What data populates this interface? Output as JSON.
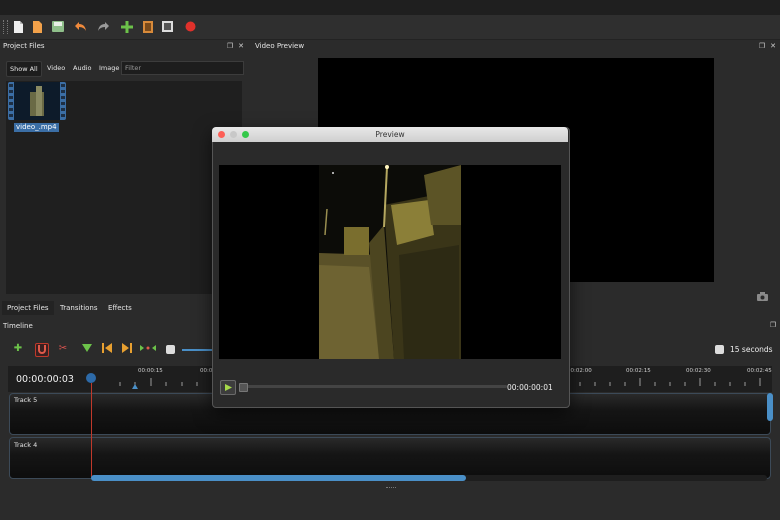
{
  "toolbar": {
    "icons": [
      "new-project-icon",
      "open-project-icon",
      "save-project-icon",
      "undo-icon",
      "redo-icon",
      "import-files-icon",
      "choose-profile-icon",
      "fullscreen-icon",
      "export-video-icon"
    ]
  },
  "project_files": {
    "title": "Project Files",
    "filters": [
      "Show All",
      "Video",
      "Audio",
      "Image"
    ],
    "filter_placeholder": "Filter",
    "file_label": "video_.mp4"
  },
  "bottom_tabs": [
    "Project Files",
    "Transitions",
    "Effects"
  ],
  "video_preview": {
    "title": "Video Preview"
  },
  "timeline": {
    "title": "Timeline",
    "current_time": "00:00:00:03",
    "zoom_label": "15 seconds",
    "ticks": [
      "00:00:15",
      "00:0",
      "00:02:00",
      "00:02:15",
      "00:02:30",
      "00:02:45"
    ],
    "tracks": [
      "Track 5",
      "Track 4"
    ]
  },
  "preview_dialog": {
    "title": "Preview",
    "time": "00:00:00:01"
  },
  "colors": {
    "accent": "#4a8fc7",
    "selection": "#3b6ea5",
    "playhead": "#c0392b",
    "play_button": "#a6d94a"
  }
}
